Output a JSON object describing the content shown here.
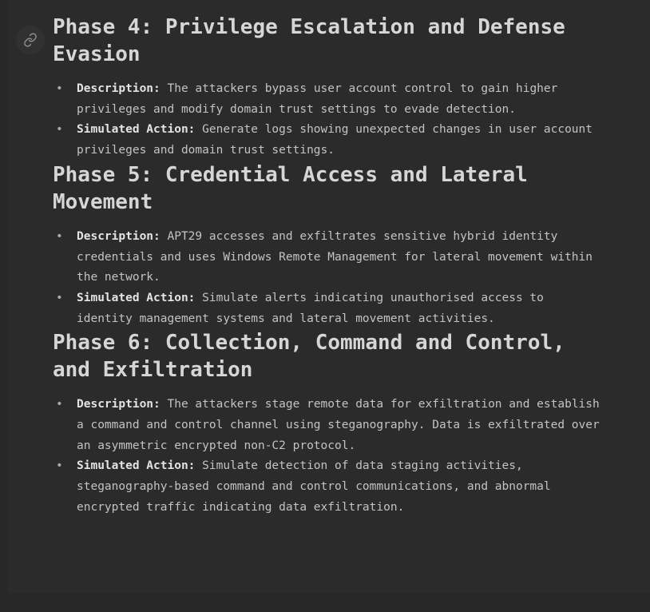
{
  "theme": {
    "background": "#2b2b2b",
    "gutter": "#282828",
    "heading_color": "#d6d6d6",
    "body_color": "#c3c3c3",
    "label_color": "#e3e3e3",
    "bullet_color": "#a8a8a8",
    "anchor_button_bg": "#313131"
  },
  "anchor": {
    "icon": "link-icon",
    "tooltip": "Permalink"
  },
  "sections": [
    {
      "heading": "Phase 4: Privilege Escalation and Defense Evasion",
      "bullets": [
        {
          "label": "Description:",
          "text": " The attackers bypass user account control to gain higher privileges and modify domain trust settings to evade detection."
        },
        {
          "label": "Simulated Action:",
          "text": " Generate logs showing unexpected changes in user account privileges and domain trust settings."
        }
      ]
    },
    {
      "heading": "Phase 5: Credential Access and Lateral Movement",
      "bullets": [
        {
          "label": "Description:",
          "text": " APT29 accesses and exfiltrates sensitive hybrid identity credentials and uses Windows Remote Management for lateral movement within the network."
        },
        {
          "label": "Simulated Action:",
          "text": " Simulate alerts indicating unauthorised access to identity management systems and lateral movement activities."
        }
      ]
    },
    {
      "heading": "Phase 6: Collection, Command and Control, and Exfiltration",
      "bullets": [
        {
          "label": "Description:",
          "text": " The attackers stage remote data for exfiltration and establish a command and control channel using steganography. Data is exfiltrated over an asymmetric encrypted non-C2 protocol."
        },
        {
          "label": "Simulated Action:",
          "text": " Simulate detection of data staging activities, steganography-based command and control communications, and abnormal encrypted traffic indicating data exfiltration."
        }
      ]
    }
  ]
}
